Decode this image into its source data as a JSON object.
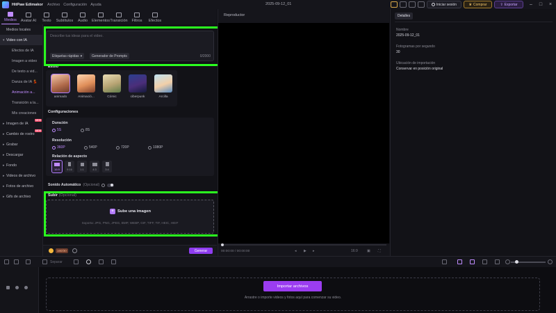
{
  "app": {
    "name": "HitPaw Edimakor",
    "menus": [
      "Archivo",
      "Configuración",
      "Ayuda"
    ],
    "document_title": "2025-09-12_01",
    "signin_label": "Iniciar sesión",
    "buy_label": "Comprar",
    "export_label": "Exportar"
  },
  "tools": [
    {
      "label": "Medios",
      "icon": "media-icon"
    },
    {
      "label": "Avatar AI",
      "icon": "avatar-icon"
    },
    {
      "label": "Texto",
      "icon": "text-icon"
    },
    {
      "label": "Subtítulos",
      "icon": "subtitles-icon"
    },
    {
      "label": "Audio",
      "icon": "audio-icon"
    },
    {
      "label": "Elementos",
      "icon": "elements-icon"
    },
    {
      "label": "Transición",
      "icon": "transition-icon"
    },
    {
      "label": "Filtros",
      "icon": "filters-icon"
    },
    {
      "label": "Efectos",
      "icon": "effects-icon"
    }
  ],
  "sidebar": {
    "items": [
      {
        "label": "Medios locales",
        "type": "top"
      },
      {
        "label": "Video con IA",
        "type": "top",
        "expanded": true
      },
      {
        "label": "Efectos de IA",
        "type": "sub"
      },
      {
        "label": "Imagen a video",
        "type": "sub"
      },
      {
        "label": "De texto a vid...",
        "type": "sub"
      },
      {
        "label": "Danza de IA 💃",
        "type": "sub"
      },
      {
        "label": "Animación a...",
        "type": "sub"
      },
      {
        "label": "Transición a la...",
        "type": "sub"
      },
      {
        "label": "Mis creaciones",
        "type": "sub"
      },
      {
        "label": "Imagen de IA",
        "type": "top",
        "badge": "NEW"
      },
      {
        "label": "Cambio de rostro",
        "type": "top",
        "badge": "NEW"
      },
      {
        "label": "Grabar",
        "type": "top"
      },
      {
        "label": "Descargar",
        "type": "top"
      },
      {
        "label": "Fondo",
        "type": "top"
      },
      {
        "label": "Videos de archivo",
        "type": "top"
      },
      {
        "label": "Fotos de archivo",
        "type": "top"
      },
      {
        "label": "Gifs de archivo",
        "type": "top"
      }
    ]
  },
  "prompt": {
    "placeholder": "Describe tus ideas para el video.",
    "quick_tags_label": "Etiquetas rápidas",
    "prompt_generator_label": "Generador de Prompts",
    "char_count": "0/2000"
  },
  "style": {
    "title": "Estilo",
    "options": [
      {
        "label": "animado",
        "selected": true
      },
      {
        "label": "Animació...",
        "selected": false
      },
      {
        "label": "Cómic",
        "selected": false
      },
      {
        "label": "ciberpunk",
        "selected": false
      },
      {
        "label": "Arcilla",
        "selected": false
      }
    ]
  },
  "config": {
    "title": "Configuraciones",
    "duration_label": "Duración",
    "durations": [
      {
        "label": "5S",
        "selected": true
      },
      {
        "label": "8S",
        "selected": false
      }
    ],
    "resolution_label": "Resolución",
    "resolutions": [
      {
        "label": "360P",
        "selected": true
      },
      {
        "label": "540P",
        "selected": false
      },
      {
        "label": "720P",
        "selected": false
      },
      {
        "label": "1080P",
        "selected": false
      }
    ],
    "aspect_label": "Relación de aspecto",
    "aspects": [
      {
        "label": "16:9",
        "selected": true
      },
      {
        "label": "9:16",
        "selected": false
      },
      {
        "label": "1:1",
        "selected": false
      },
      {
        "label": "4:3",
        "selected": false
      },
      {
        "label": "3:4",
        "selected": false
      }
    ]
  },
  "sound": {
    "label": "Sonido Automático",
    "optional": "(Opcional)"
  },
  "upload": {
    "title": "Subir",
    "optional": "(Opcional)",
    "button_label": "Sube una imagen",
    "formats": "Soporta: JPG, PNG, JPEG, BMP, WEBP, GIF, TIFF, TIF, HEIC, HEIF"
  },
  "footer": {
    "credits": "160/30",
    "generate_label": "Generar"
  },
  "player": {
    "title": "Reproductor",
    "timecode": "00:00:00 / 00:00:00",
    "zoom": "16:9"
  },
  "details": {
    "tab": "Detalles",
    "fields": [
      {
        "label": "Nombre",
        "value": "2025-09-12_01"
      },
      {
        "label": "Fotogramas por segundo",
        "value": "30"
      },
      {
        "label": "Ubicación de importación",
        "value": "Conservar en posición original"
      }
    ]
  },
  "timeline": {
    "separate_label": "Separar",
    "import_label": "Importar archivos",
    "drop_hint": "Arrastre o importe videos y fotos aquí para comenzar su video."
  }
}
